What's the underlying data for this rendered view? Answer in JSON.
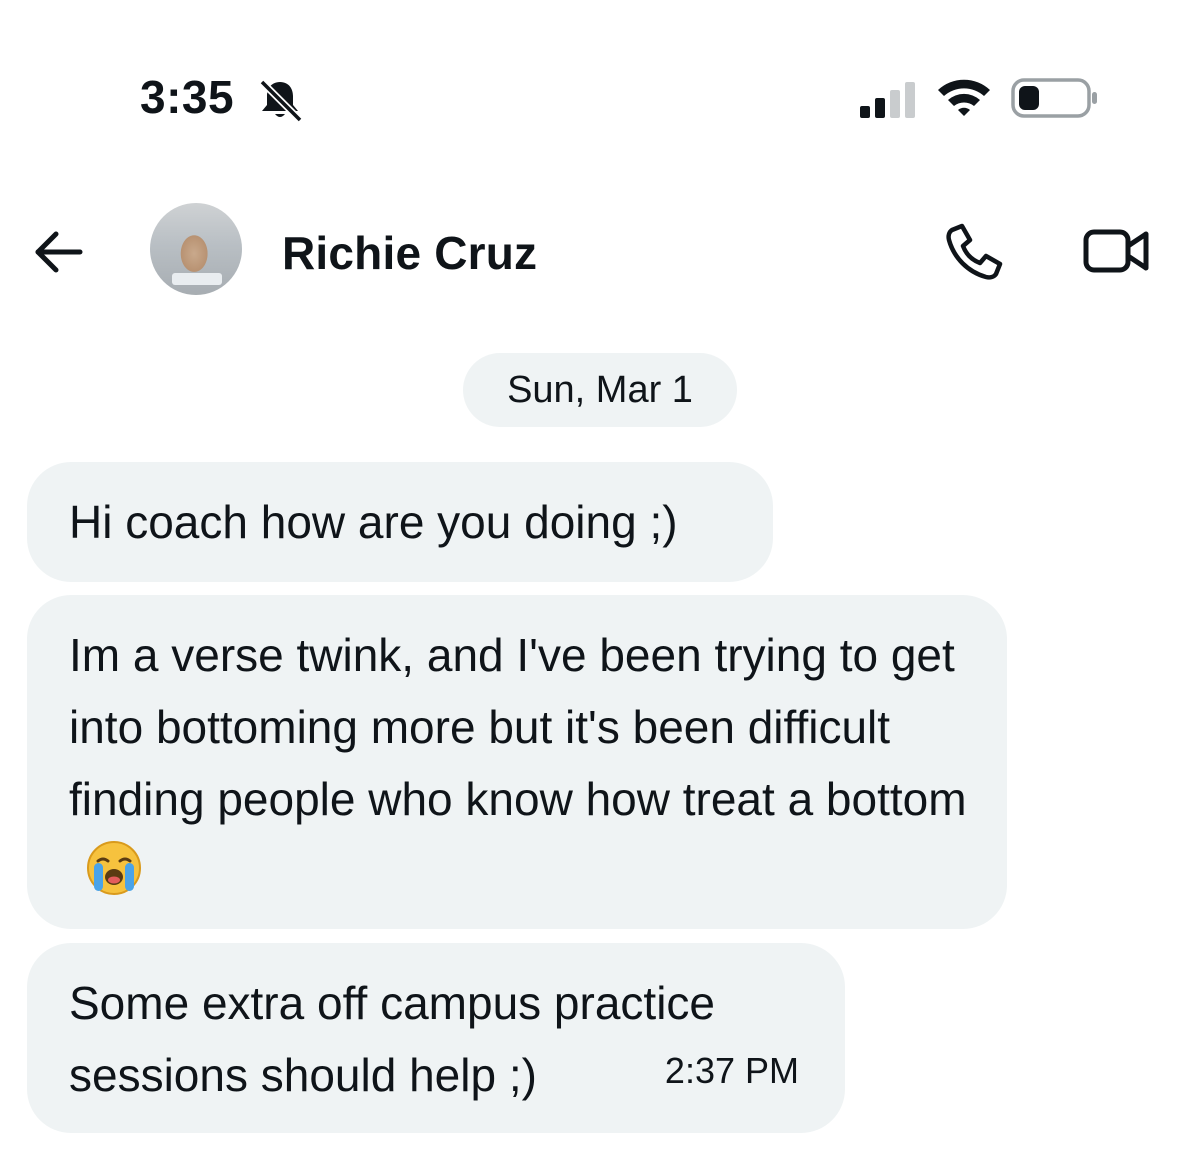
{
  "status_bar": {
    "time": "3:35",
    "icons": [
      "bell-muted-icon",
      "signal-icon",
      "wifi-icon",
      "battery-icon"
    ]
  },
  "header": {
    "contact_name": "Richie Cruz",
    "icons": [
      "back-arrow-icon",
      "phone-icon",
      "video-camera-icon"
    ]
  },
  "conversation": {
    "date_label": "Sun, Mar 1",
    "messages": [
      {
        "text": "Hi coach how are you doing ;)"
      },
      {
        "text": "Im a verse twink, and I've been trying to get into bottoming more but it's been difficult finding people who know how treat a bottom",
        "emoji": "loudly-crying-face-icon"
      },
      {
        "text": "Some extra off campus practice\nsessions should help ;)",
        "timestamp": "2:37 PM"
      }
    ]
  },
  "colors": {
    "bubble_bg": "#eff3f4",
    "text": "#0f1419",
    "background": "#ffffff"
  }
}
